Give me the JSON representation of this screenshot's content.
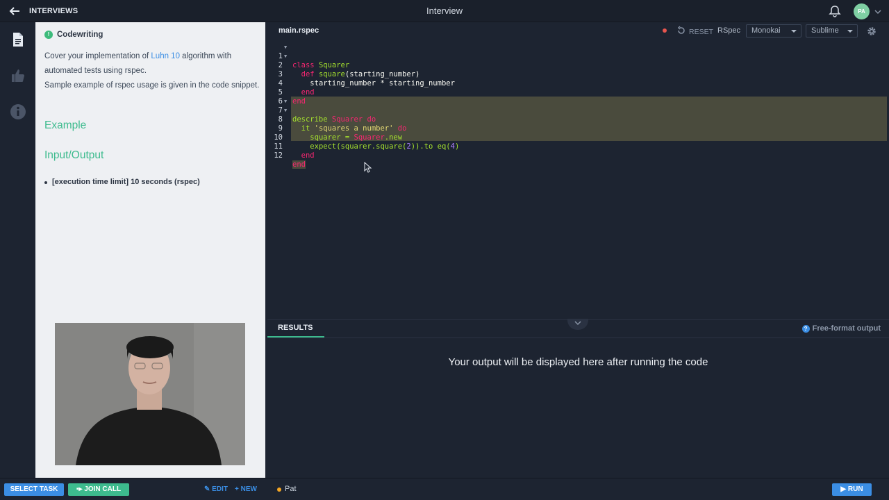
{
  "topbar": {
    "back_icon": "arrow-left-icon",
    "brand": "INTERVIEWS",
    "title": "Interview",
    "bell_icon": "bell-icon",
    "avatar_initials": "PA"
  },
  "rail": {
    "items": [
      {
        "icon": "document-icon",
        "active": true
      },
      {
        "icon": "thumbs-up-icon",
        "active": false
      },
      {
        "icon": "info-icon",
        "active": false
      }
    ]
  },
  "task": {
    "type": "Codewriting",
    "line1_before": "Cover your implementation of ",
    "link": "Luhn 10",
    "line1_after": " algorithm with automated tests using rspec.",
    "line2": "Sample example of rspec usage is given in the code snippet.",
    "example_heading": "Example",
    "io_heading": "Input/Output",
    "limit": "[execution time limit] 10 seconds (rspec)"
  },
  "editor": {
    "file_tab": "main.rspec",
    "reset_label": "RESET",
    "language": "RSpec",
    "theme": "Monokai",
    "keymap": "Sublime",
    "lines": [
      {
        "n": "1",
        "fold": true
      },
      {
        "n": "2",
        "fold": true
      },
      {
        "n": "3",
        "fold": false
      },
      {
        "n": "4",
        "fold": false
      },
      {
        "n": "5",
        "fold": false
      },
      {
        "n": "6",
        "fold": false
      },
      {
        "n": "7",
        "fold": true
      },
      {
        "n": "8",
        "fold": true
      },
      {
        "n": "9",
        "fold": false
      },
      {
        "n": "10",
        "fold": false
      },
      {
        "n": "11",
        "fold": false
      },
      {
        "n": "12",
        "fold": false
      }
    ],
    "code": {
      "l1_kw": "class",
      "l1_name": "Squarer",
      "l2_kw": "def",
      "l2_name": "square",
      "l2_rest": "(starting_number)",
      "l3": "starting_number * starting_number",
      "l4": "end",
      "l5": "end",
      "l7_fn": "describe",
      "l7_name": "Squarer",
      "l7_kw": "do",
      "l8_fn": "it",
      "l8_str": "'squares a number'",
      "l8_kw": "do",
      "l9_a": "squarer = ",
      "l9_cls": "Squarer",
      "l9_b": ".new",
      "l10_a": "expect(squarer.square(",
      "l10_n1": "2",
      "l10_b": ")).to eq(",
      "l10_n2": "4",
      "l10_c": ")",
      "l11": "end",
      "l12": "end"
    }
  },
  "results": {
    "tab": "RESULTS",
    "free_format": "Free-format output",
    "placeholder": "Your output will be displayed here after running the code"
  },
  "bottombar": {
    "select_task": "SELECT TASK",
    "join_call": "JOIN CALL",
    "edit": "EDIT",
    "new": "NEW",
    "user": "Pat",
    "run": "RUN"
  },
  "colors": {
    "accent_blue": "#3b8ee4",
    "accent_green": "#3dbb8e",
    "background": "#1d2431"
  }
}
